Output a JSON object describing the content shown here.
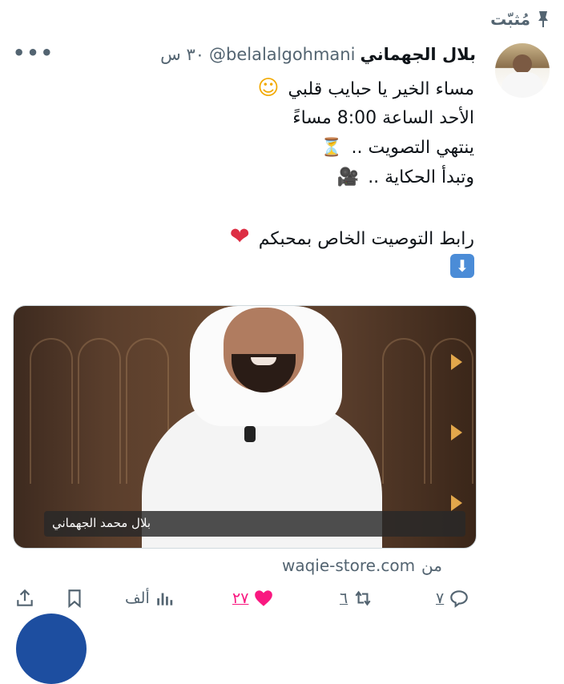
{
  "pinned": {
    "label": "مُثبّت",
    "icon": "pin-icon"
  },
  "author": {
    "name": "بلال الجهماني",
    "handle": "@belalalgohmani",
    "time": "٣٠ س",
    "avatar": "avatar"
  },
  "tweet": {
    "lines": [
      "مساء الخير يا حبايب قلبي",
      "الأحد الساعة 8:00 مساءً",
      "ينتهي التصويت ..",
      "وتبدأ الحكاية ..",
      "رابط التوصيت الخاص بمحبكم"
    ],
    "emojis": [
      "☺",
      "⏳",
      "🎥",
      "❤",
      "⬇"
    ]
  },
  "card": {
    "caption": "بلال محمد الجهماني",
    "source_prefix": "من",
    "source_domain": "waqie-store.com"
  },
  "actions": {
    "replies": "٧",
    "retweets": "٦",
    "likes": "٢٧",
    "views": "ألف",
    "like_color": "#f91880"
  },
  "colors": {
    "secondary": "#536471",
    "accent": "#1d9bf0"
  }
}
